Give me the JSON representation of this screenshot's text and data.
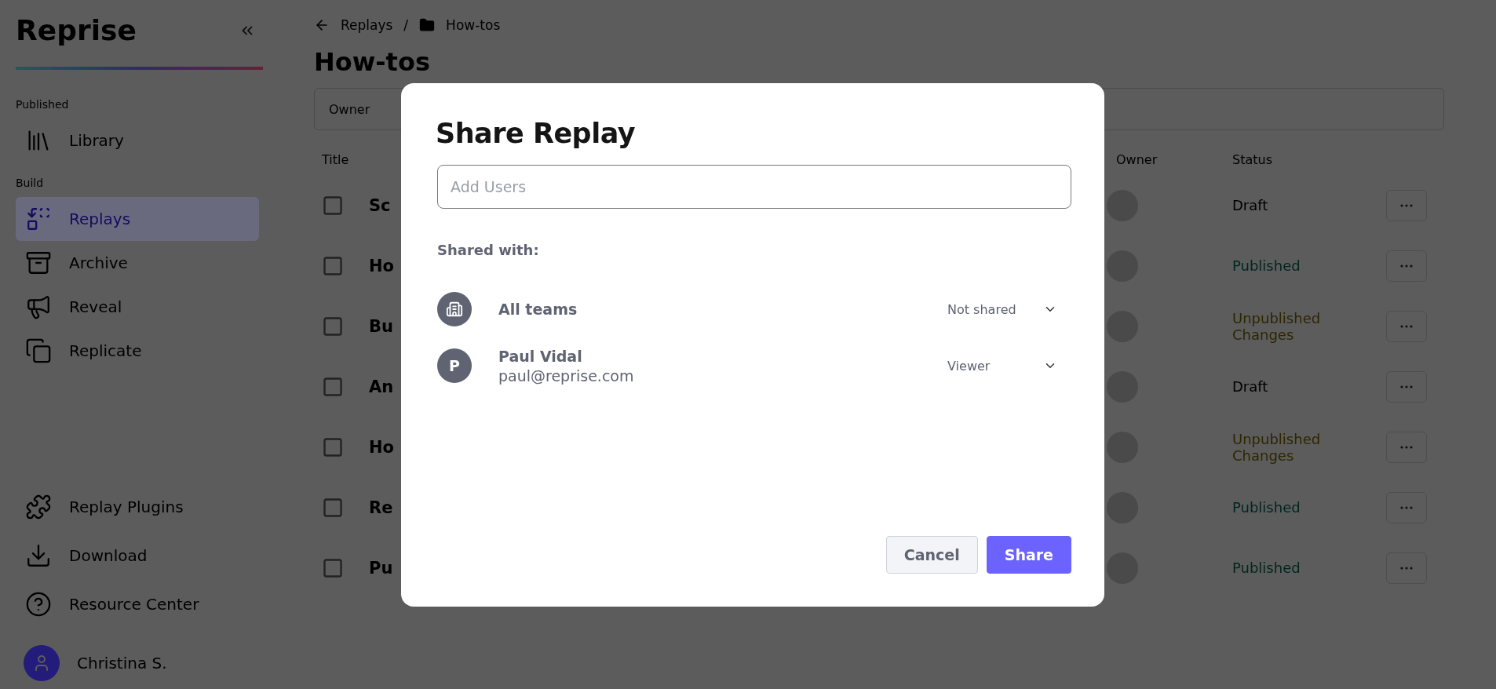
{
  "sidebar": {
    "logo": "Reprise",
    "sections": [
      {
        "heading": "Published",
        "items": [
          {
            "label": "Library",
            "selected": false
          }
        ]
      },
      {
        "heading": "Build",
        "items": [
          {
            "label": "Replays",
            "selected": true
          },
          {
            "label": "Archive",
            "selected": false
          },
          {
            "label": "Reveal",
            "selected": false
          },
          {
            "label": "Replicate",
            "selected": false
          }
        ]
      }
    ],
    "footer_items": [
      {
        "label": "Replay Plugins"
      },
      {
        "label": "Download"
      },
      {
        "label": "Resource Center"
      }
    ],
    "user": {
      "name": "Christina S."
    }
  },
  "breadcrumb": {
    "items": [
      "Replays",
      "How-tos"
    ],
    "separator": "/"
  },
  "page_title": "How-tos",
  "filter": {
    "placeholder": "Owner"
  },
  "table": {
    "columns": [
      "Title",
      "Owner",
      "Status"
    ],
    "rows": [
      {
        "title": "Sc",
        "status": "Draft",
        "kind": "draft"
      },
      {
        "title": "Ho",
        "status": "Published",
        "kind": "published"
      },
      {
        "title": "Bu",
        "status": "Unpublished Changes",
        "kind": "unpublished"
      },
      {
        "title": "An",
        "status": "Draft",
        "kind": "draft"
      },
      {
        "title": "Ho",
        "status": "Unpublished Changes",
        "kind": "unpublished"
      },
      {
        "title": "Re",
        "status": "Published",
        "kind": "published"
      },
      {
        "title": "Pu",
        "status": "Published",
        "kind": "published"
      }
    ]
  },
  "modal": {
    "title": "Share Replay",
    "input": {
      "placeholder": "Add Users"
    },
    "shared_label": "Shared with:",
    "entries": [
      {
        "kind": "team",
        "name": "All teams",
        "role": "Not shared"
      },
      {
        "kind": "user",
        "initial": "P",
        "name": "Paul Vidal",
        "email": "paul@reprise.com",
        "role": "Viewer"
      }
    ],
    "buttons": [
      {
        "label": "Cancel",
        "kind": "secondary"
      },
      {
        "label": "Share",
        "kind": "primary"
      }
    ]
  }
}
